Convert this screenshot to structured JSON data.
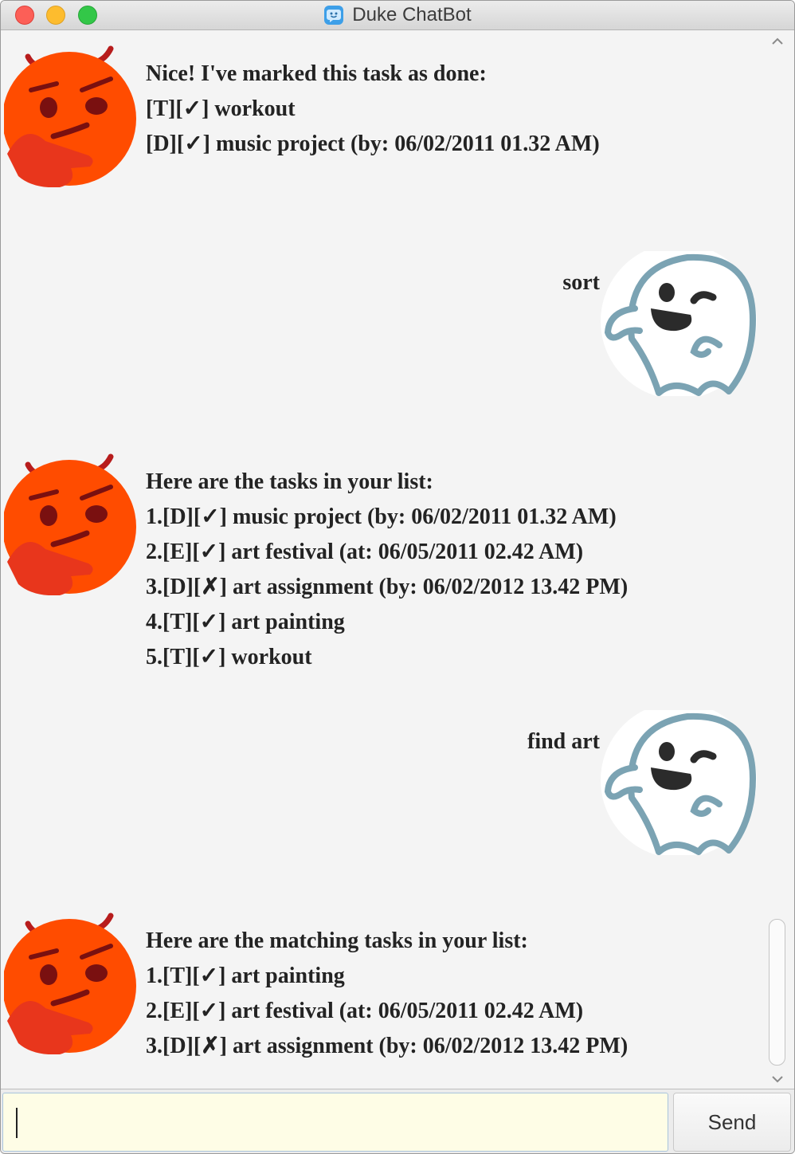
{
  "window": {
    "title": "Duke ChatBot"
  },
  "messages": [
    {
      "sender": "duke",
      "lines": [
        "Nice! I've marked this task as done:",
        "[T][✓] workout",
        "[D][✓] music project (by: 06/02/2011 01.32 AM)"
      ]
    },
    {
      "sender": "user",
      "text": "sort"
    },
    {
      "sender": "duke",
      "lines": [
        "Here are the tasks in your list:",
        "1.[D][✓] music project (by: 06/02/2011 01.32 AM)",
        "2.[E][✓] art festival (at: 06/05/2011 02.42 AM)",
        "3.[D][✗] art assignment (by: 06/02/2012 13.42 PM)",
        "4.[T][✓] art painting",
        "5.[T][✓] workout"
      ]
    },
    {
      "sender": "user",
      "text": "find art"
    },
    {
      "sender": "duke",
      "lines": [
        "Here are the matching tasks in your list:",
        "1.[T][✓] art painting",
        "2.[E][✓] art festival (at: 06/05/2011 02.42 AM)",
        "3.[D][✗] art assignment (by: 06/02/2012 13.42 PM)"
      ]
    }
  ],
  "input": {
    "value": ""
  },
  "send_button": {
    "label": "Send"
  },
  "icons": {
    "duke_avatar": "thinking-devil-face-icon",
    "user_avatar": "ghost-icon",
    "app": "chat-bubble-icon"
  },
  "colors": {
    "duke_avatar": "#ff4c00",
    "user_avatar_outline": "#7ba3b3",
    "input_background": "#fefde6"
  }
}
